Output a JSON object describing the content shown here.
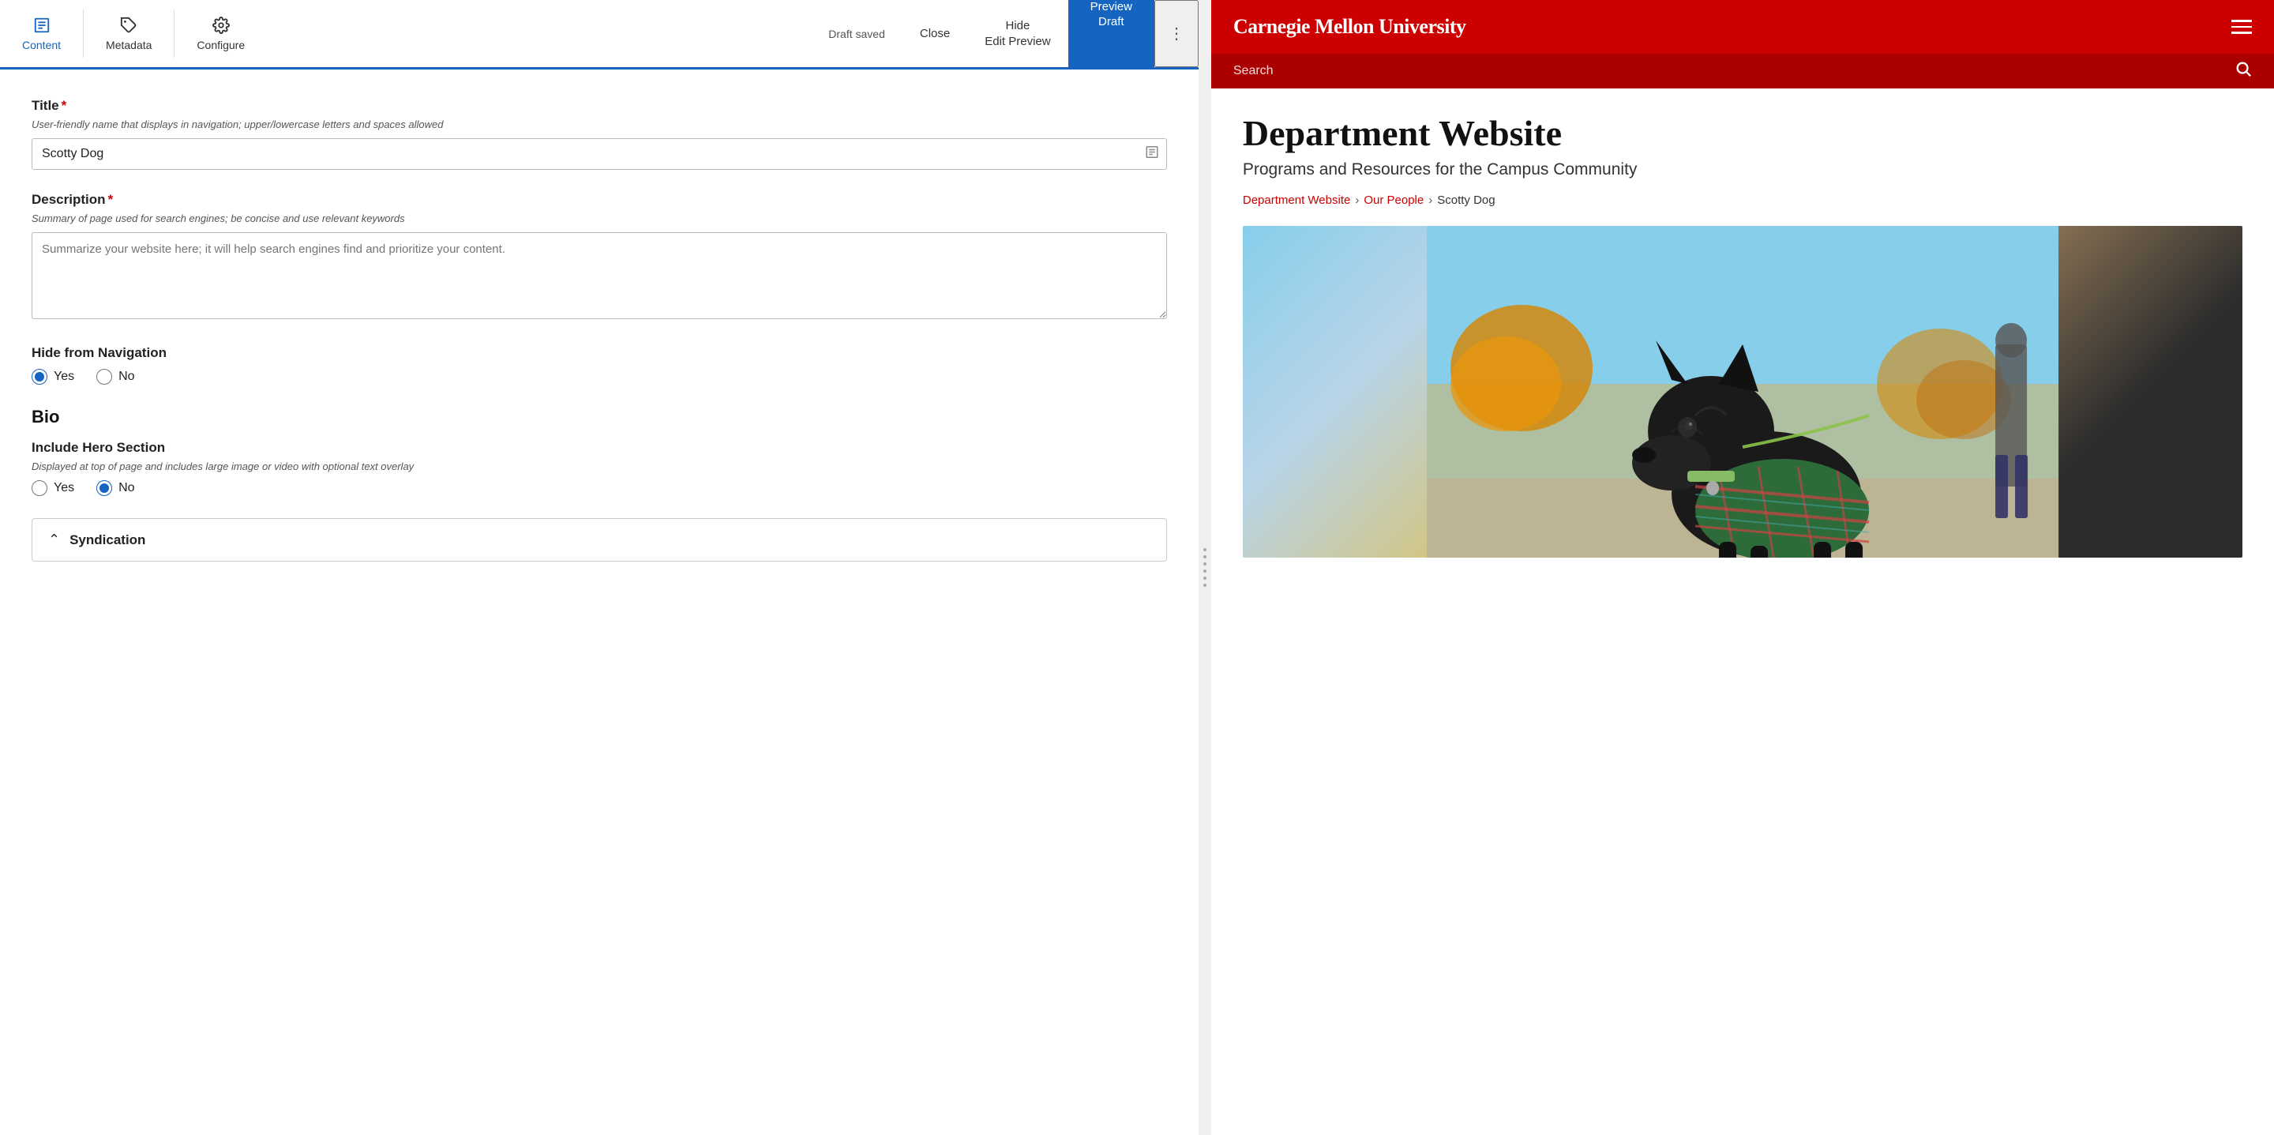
{
  "toolbar": {
    "tabs": [
      {
        "id": "content",
        "label": "Content",
        "active": true
      },
      {
        "id": "metadata",
        "label": "Metadata",
        "active": false
      },
      {
        "id": "configure",
        "label": "Configure",
        "active": false
      }
    ],
    "draft_status": "Draft saved",
    "close_label": "Close",
    "hide_edit_preview": "Hide\nEdit Preview",
    "preview_draft_line1": "Preview",
    "preview_draft_line2": "Draft",
    "dots_label": "⋮"
  },
  "form": {
    "title_label": "Title",
    "title_required": "*",
    "title_hint": "User-friendly name that displays in navigation; upper/lowercase letters and spaces allowed",
    "title_value": "Scotty Dog",
    "description_label": "Description",
    "description_required": "*",
    "description_hint": "Summary of page used for search engines; be concise and use relevant keywords",
    "description_placeholder": "Summarize your website here; it will help search engines find and prioritize your content.",
    "hide_from_nav_label": "Hide from Navigation",
    "nav_yes": "Yes",
    "nav_no": "No",
    "bio_section": "Bio",
    "include_hero_label": "Include Hero Section",
    "hero_hint": "Displayed at top of page and includes large image or video with optional text overlay",
    "hero_yes": "Yes",
    "hero_no": "No",
    "syndication_label": "Syndication"
  },
  "preview": {
    "university_name": "Carnegie Mellon University",
    "search_placeholder": "Search",
    "page_title": "Department Website",
    "page_subtitle": "Programs and Resources for the Campus Community",
    "breadcrumb_root": "Department Website",
    "breadcrumb_mid": "Our People",
    "breadcrumb_current": "Scotty Dog",
    "breadcrumb_sep": "›"
  }
}
